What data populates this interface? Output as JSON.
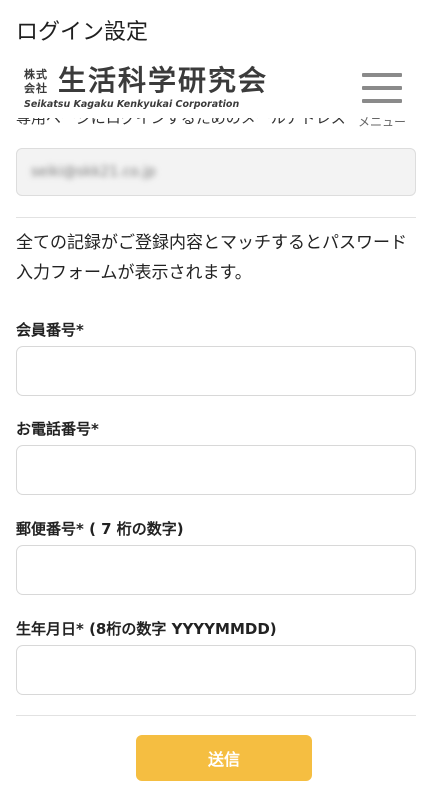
{
  "header": {
    "page_title": "ログイン設定",
    "logo": {
      "kabushiki": "株式会社",
      "name": "生活科学研究会",
      "english": "Seikatsu Kagaku Kenkyukai Corporation"
    },
    "menu_label": "メニュー",
    "menu_icon": "hamburger-icon"
  },
  "email_section": {
    "label": "専用ページにログインするためのメールアドレス",
    "value": "seiki@skk21.co.jp"
  },
  "notice": "全ての記録がご登録内容とマッチするとパスワード入力フォームが表示されます。",
  "fields": [
    {
      "label": "会員番号*",
      "value": "",
      "placeholder": ""
    },
    {
      "label": "お電話番号*",
      "value": "",
      "placeholder": ""
    },
    {
      "label": "郵便番号* ( 7 桁の数字)",
      "value": "",
      "placeholder": ""
    },
    {
      "label": "生年月日* (8桁の数字 YYYYMMDD)",
      "value": "",
      "placeholder": ""
    }
  ],
  "submit_label": "送信",
  "colors": {
    "submit_bg": "#f5be41",
    "logo_text": "#3b3b3b",
    "input_border": "#d8d8d8",
    "disabled_bg": "#f3f3f3"
  }
}
